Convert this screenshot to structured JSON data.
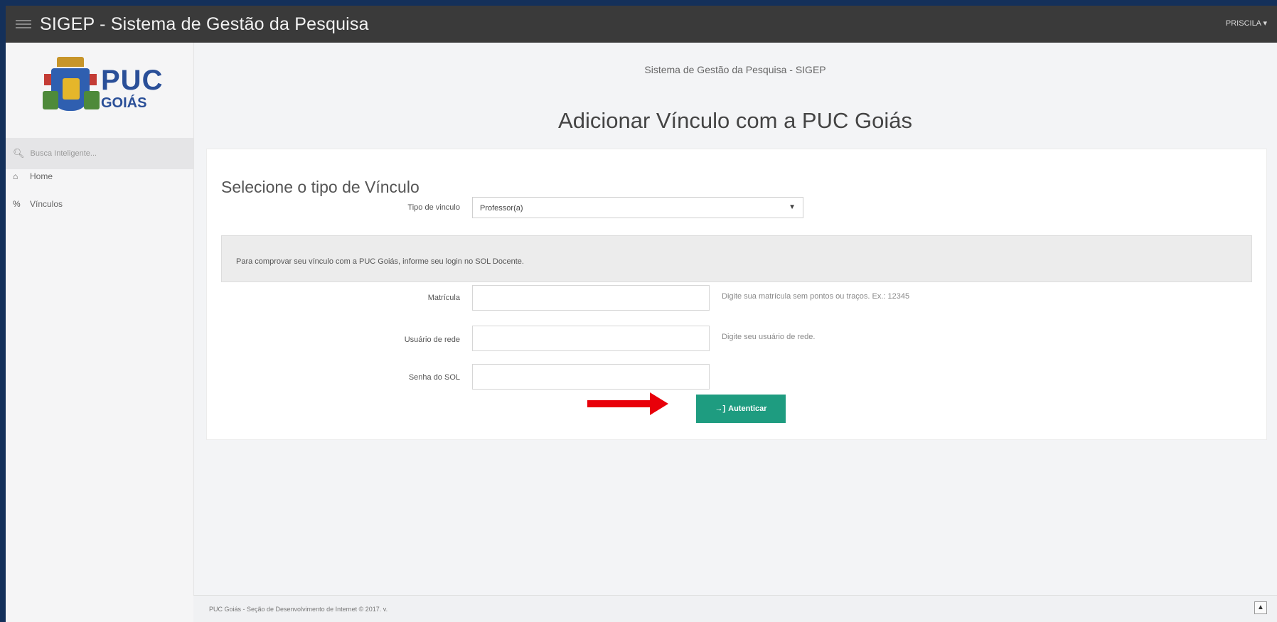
{
  "header": {
    "app_title": "SIGEP - Sistema de Gestão da Pesquisa",
    "user_menu": "PRISCILA ▾"
  },
  "sidebar": {
    "logo": {
      "line1": "PUC",
      "line2": "GOIÁS"
    },
    "search_placeholder": "Busca Inteligente...",
    "items": [
      {
        "icon": "home-icon",
        "label": "Home"
      },
      {
        "icon": "link-icon",
        "label": "Vínculos"
      }
    ]
  },
  "main": {
    "system_title": "Sistema de Gestão da Pesquisa - SIGEP",
    "page_title": "Adicionar Vínculo com a PUC Goiás",
    "panel": {
      "heading": "Selecione o tipo de Vínculo",
      "tipo_label": "Tipo de vinculo",
      "tipo_value": "Professor(a)",
      "info_text": "Para comprovar seu vínculo com a PUC Goiás, informe seu login no SOL Docente.",
      "fields": {
        "matricula_label": "Matrícula",
        "matricula_value": "",
        "matricula_help": "Digite sua matrícula sem pontos ou traços. Ex.: 12345",
        "usuario_label": "Usuário de rede",
        "usuario_value": "",
        "usuario_help": "Digite seu usuário de rede.",
        "senha_label": "Senha do SOL",
        "senha_value": ""
      },
      "button_label": "Autenticar"
    }
  },
  "footer": {
    "text": "PUC Goiás - Seção de Desenvolvimento de Internet © 2017. v."
  },
  "colors": {
    "accent": "#1e9c80",
    "arrow": "#e8000a",
    "topbar": "#3a3a3a"
  }
}
